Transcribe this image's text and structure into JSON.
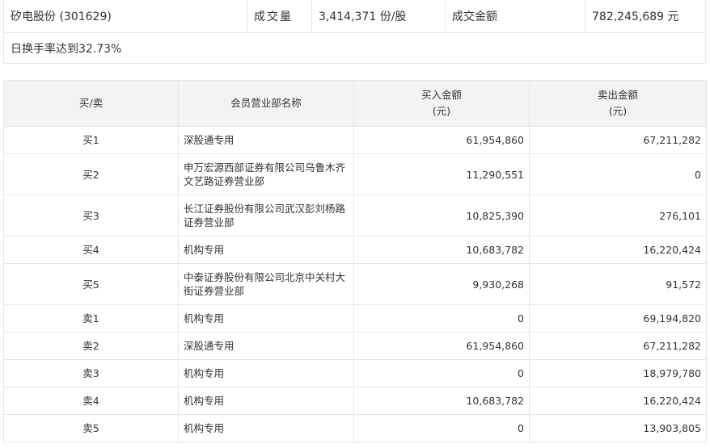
{
  "summary": {
    "stock_name": "矽电股份 (301629)",
    "volume_label": "成交量",
    "volume_value": "3,414,371 份/股",
    "amount_label": "成交金额",
    "amount_value": "782,245,689 元",
    "note": "日换手率达到32.73%"
  },
  "table": {
    "headers": {
      "side": "买/卖",
      "member": "会员营业部名称",
      "buy_line1": "买入金额",
      "buy_line2": "(元)",
      "sell_line1": "卖出金额",
      "sell_line2": "(元)"
    },
    "rows": [
      {
        "side": "买1",
        "member": "深股通专用",
        "buy": "61,954,860",
        "sell": "67,211,282"
      },
      {
        "side": "买2",
        "member": "申万宏源西部证券有限公司乌鲁木齐文艺路证券营业部",
        "buy": "11,290,551",
        "sell": "0"
      },
      {
        "side": "买3",
        "member": "长江证券股份有限公司武汉彭刘杨路证券营业部",
        "buy": "10,825,390",
        "sell": "276,101"
      },
      {
        "side": "买4",
        "member": "机构专用",
        "buy": "10,683,782",
        "sell": "16,220,424"
      },
      {
        "side": "买5",
        "member": "中泰证券股份有限公司北京中关村大街证券营业部",
        "buy": "9,930,268",
        "sell": "91,572"
      },
      {
        "side": "卖1",
        "member": "机构专用",
        "buy": "0",
        "sell": "69,194,820"
      },
      {
        "side": "卖2",
        "member": "深股通专用",
        "buy": "61,954,860",
        "sell": "67,211,282"
      },
      {
        "side": "卖3",
        "member": "机构专用",
        "buy": "0",
        "sell": "18,979,780"
      },
      {
        "side": "卖4",
        "member": "机构专用",
        "buy": "10,683,782",
        "sell": "16,220,424"
      },
      {
        "side": "卖5",
        "member": "机构专用",
        "buy": "0",
        "sell": "13,903,805"
      }
    ]
  }
}
